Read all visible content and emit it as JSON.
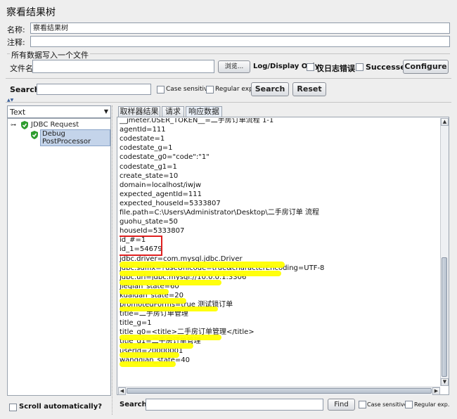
{
  "window_title": "察看结果树",
  "name_label": "名称:",
  "name_value": "察看结果树",
  "comment_label": "注释:",
  "comment_value": "",
  "file_section_title": "所有数据写入一个文件",
  "filename_label": "文件名",
  "filename_value": "",
  "browse_label": "浏览...",
  "log_display_label": "Log/Display Only:",
  "errors_only_label": "仅日志错误",
  "successes_label": "Successes",
  "configure_label": "Configure",
  "search": {
    "label": "Search:",
    "value": "",
    "case_sensitive_label": "Case sensitive",
    "regexp_label": "Regular exp.",
    "search_button": "Search",
    "reset_button": "Reset"
  },
  "renderer_select": "Text",
  "tree": {
    "root": "JDBC Request",
    "child": "Debug PostProcessor"
  },
  "tabs": [
    "取样器结果",
    "请求",
    "响应数据"
  ],
  "active_tab": "响应数据",
  "response_lines": [
    "__jmeter.USER_TOKEN__=二手房订单流程 1-1",
    "agentId=111",
    "codestate=1",
    "codestate_g=1",
    "codestate_g0=\"code\":\"1\"",
    "codestate_g1=1",
    "create_state=10",
    "domain=localhost/iwjw",
    "expected_agentId=111",
    "expected_houseId=5333807",
    "file.path=C:\\Users\\Administrator\\Desktop\\二手房订单 流程",
    "guohu_state=50",
    "houseId=5333807",
    "id_#=1",
    "id_1=54679",
    "jdbc.driver=com.mysql.jdbc.Driver",
    "jdbc.suffix=?useUnicode=true&characterEncoding=UTF-8",
    "jdbc.url=jdbc:mysql://10.0.0.1:3306",
    "jieqian_state=60",
    "kuaidan_state=20",
    "promotedForms=true 测试锁订单",
    "title=二手房订单管理",
    "title_g=1",
    "title_g0=<title>二手房订单管理</title>",
    "title_g1=二手房订单管理",
    "userId=20000001",
    "wangqian_state=40"
  ],
  "highlight_color": "#ffff00",
  "box_color": "#e02020",
  "bottom_search": {
    "label": "Search:",
    "value": "",
    "find_button": "Find",
    "case_sensitive_label": "Case sensitive",
    "regexp_label": "Regular exp."
  },
  "scroll_auto_label": "Scroll automatically?"
}
